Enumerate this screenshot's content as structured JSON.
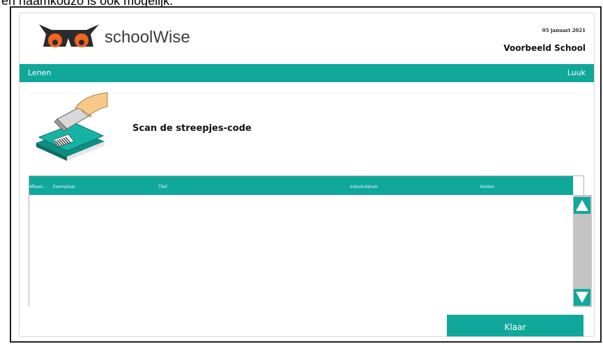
{
  "caption": "en naamkodzo is ook mogelijk.",
  "header": {
    "brand": "schoolWise",
    "date": "05 januari 2021",
    "school": "Voorbeeld School"
  },
  "topbar": {
    "section": "Lenen",
    "user": "Luuk"
  },
  "scan": {
    "instruction": "Scan de streepjes-code"
  },
  "table": {
    "columns": {
      "afbeelding": "Afbeel...",
      "exemplaar": "Exemplaar",
      "titel": "Titel",
      "inleverdatum": "Inleverdatum",
      "kosten": "Kosten"
    },
    "rows": []
  },
  "actions": {
    "done": "Klaar"
  },
  "colors": {
    "accent": "#0fa89b",
    "logo_orange": "#f26522",
    "logo_dark": "#2b2b2b",
    "scrollbar": "#c4c4c4"
  }
}
